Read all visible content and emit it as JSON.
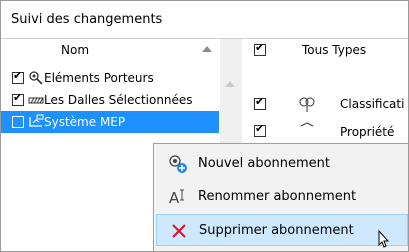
{
  "window": {
    "title": "Suivi des changements"
  },
  "left": {
    "column_header": "Nom",
    "rows": [
      {
        "label": "Eléments Porteurs",
        "checked": true,
        "icon": "structural-elements-icon"
      },
      {
        "label": "Les Dalles Sélectionnées",
        "checked": true,
        "icon": "slab-icon"
      },
      {
        "label": "Système MEP",
        "checked": false,
        "icon": "mep-system-icon",
        "selected": true
      }
    ]
  },
  "right": {
    "header_label": "Tous Types",
    "rows": [
      {
        "label": "Classificati",
        "checked": true,
        "icon": "classification-icon"
      },
      {
        "label": "Propriété",
        "checked": true,
        "icon": "properties-icon"
      }
    ]
  },
  "context_menu": {
    "items": [
      {
        "label": "Nouvel abonnement",
        "icon": "new-subscription-icon"
      },
      {
        "label": "Renommer abonnement",
        "icon": "rename-icon"
      },
      {
        "label": "Supprimer abonnement",
        "icon": "delete-icon",
        "hover": true
      }
    ]
  },
  "colors": {
    "selection": "#1e90ff",
    "menu_hover": "#cde8ff",
    "delete_red": "#e81123"
  }
}
